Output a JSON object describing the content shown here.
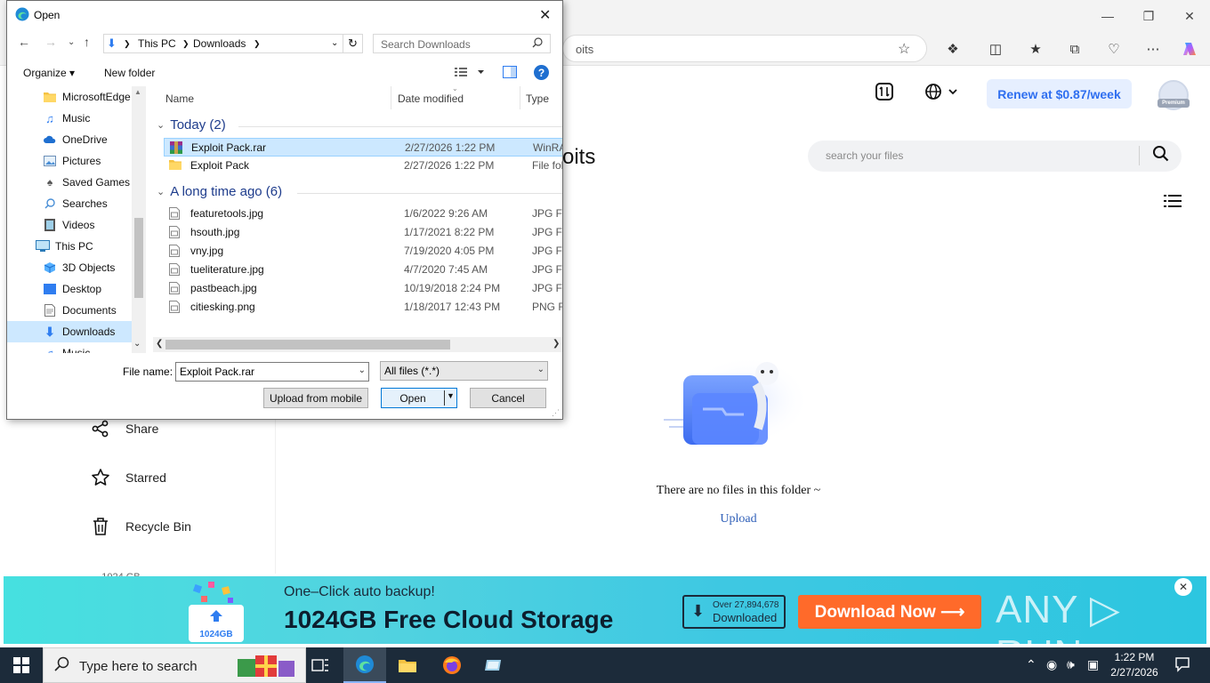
{
  "browser": {
    "address_fragment": "oits",
    "renew_label": "Renew at $0.87/week",
    "premium_label": "Premium",
    "page_title_fragment": "oits",
    "search_placeholder": "search your files",
    "empty_text": "There are no files in this folder ~",
    "upload_link": "Upload",
    "sidebar": [
      {
        "label": "Share",
        "icon": "share-icon"
      },
      {
        "label": "Starred",
        "icon": "star-icon"
      },
      {
        "label": "Recycle Bin",
        "icon": "trash-icon"
      }
    ],
    "sidebar_cut_text": "...  1024 GB"
  },
  "ad": {
    "line1": "One–Click auto backup!",
    "line2": "1024GB Free Cloud Storage",
    "logo_label": "1024GB",
    "dl_count_l1": "Over 27,894,678",
    "dl_count_l2": "Downloaded",
    "dl_button": "Download Now ⟶",
    "brand": "ANY ▷ RUN"
  },
  "dialog": {
    "title": "Open",
    "path": [
      "This PC",
      "Downloads"
    ],
    "search_placeholder": "Search Downloads",
    "organize": "Organize ▾",
    "new_folder": "New folder",
    "nav_items": [
      {
        "label": "MicrosoftEdge",
        "icon": "folder-icon",
        "indent": 1
      },
      {
        "label": "Music",
        "icon": "music-icon",
        "indent": 1
      },
      {
        "label": "OneDrive",
        "icon": "cloud-icon",
        "indent": 1
      },
      {
        "label": "Pictures",
        "icon": "pictures-icon",
        "indent": 1
      },
      {
        "label": "Saved Games",
        "icon": "games-icon",
        "indent": 1
      },
      {
        "label": "Searches",
        "icon": "search-icon",
        "indent": 1
      },
      {
        "label": "Videos",
        "icon": "videos-icon",
        "indent": 1
      },
      {
        "label": "This PC",
        "icon": "computer-icon",
        "indent": 0
      },
      {
        "label": "3D Objects",
        "icon": "cube-icon",
        "indent": 1
      },
      {
        "label": "Desktop",
        "icon": "desktop-icon",
        "indent": 1
      },
      {
        "label": "Documents",
        "icon": "documents-icon",
        "indent": 1
      },
      {
        "label": "Downloads",
        "icon": "download-icon",
        "indent": 1,
        "selected": true
      },
      {
        "label": "Music",
        "icon": "music-icon",
        "indent": 1
      }
    ],
    "columns": {
      "name": "Name",
      "date": "Date modified",
      "type": "Type"
    },
    "groups": [
      {
        "label": "Today (2)",
        "files": [
          {
            "name": "Exploit Pack.rar",
            "date": "2/27/2026 1:22 PM",
            "type": "WinRAR",
            "icon": "winrar-icon",
            "selected": true
          },
          {
            "name": "Exploit Pack",
            "date": "2/27/2026 1:22 PM",
            "type": "File fold",
            "icon": "folder-icon"
          }
        ]
      },
      {
        "label": "A long time ago (6)",
        "files": [
          {
            "name": "featuretools.jpg",
            "date": "1/6/2022 9:26 AM",
            "type": "JPG File",
            "icon": "image-file-icon"
          },
          {
            "name": "hsouth.jpg",
            "date": "1/17/2021 8:22 PM",
            "type": "JPG File",
            "icon": "image-file-icon"
          },
          {
            "name": "vny.jpg",
            "date": "7/19/2020 4:05 PM",
            "type": "JPG File",
            "icon": "image-file-icon"
          },
          {
            "name": "tueliterature.jpg",
            "date": "4/7/2020 7:45 AM",
            "type": "JPG File",
            "icon": "image-file-icon"
          },
          {
            "name": "pastbeach.jpg",
            "date": "10/19/2018 2:24 PM",
            "type": "JPG File",
            "icon": "image-file-icon"
          },
          {
            "name": "citiesking.png",
            "date": "1/18/2017 12:43 PM",
            "type": "PNG File",
            "icon": "image-file-icon"
          }
        ]
      }
    ],
    "file_name_label": "File name:",
    "file_name_value": "Exploit Pack.rar",
    "file_type_value": "All files (*.*)",
    "upload_mobile": "Upload from mobile",
    "open": "Open",
    "cancel": "Cancel"
  },
  "taskbar": {
    "search_text": "Type here to search",
    "time": "1:22 PM",
    "date": "2/27/2026"
  }
}
